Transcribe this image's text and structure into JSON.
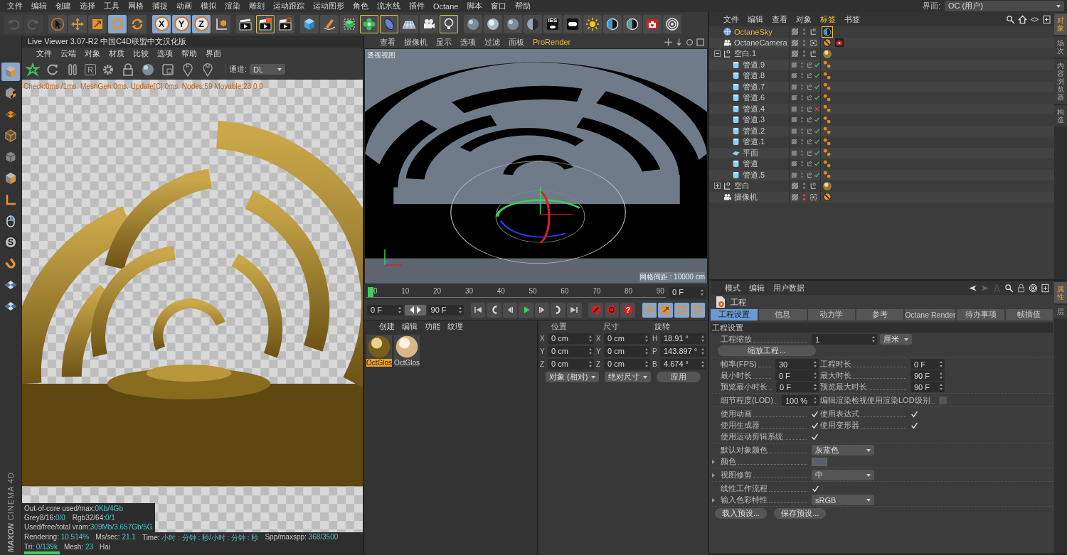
{
  "menu_bar": {
    "items": [
      "文件",
      "编辑",
      "创建",
      "选择",
      "工具",
      "网格",
      "捕捉",
      "动画",
      "模拟",
      "渲染",
      "雕刻",
      "运动跟踪",
      "运动图形",
      "角色",
      "流水线",
      "插件",
      "Octane",
      "脚本",
      "窗口",
      "帮助"
    ],
    "layout_label": "界面:",
    "layout_value": "OC (用户)"
  },
  "toolbar": {
    "groups": [
      [
        {
          "kind": "undo",
          "selected": false,
          "disabled": true
        },
        {
          "kind": "redo",
          "selected": false,
          "disabled": true
        }
      ],
      [
        {
          "kind": "cursor",
          "selected": false,
          "disabled": false
        },
        {
          "kind": "move",
          "selected": false,
          "disabled": false
        },
        {
          "kind": "scale",
          "selected": false,
          "disabled": false
        },
        {
          "kind": "rotate",
          "selected": true,
          "disabled": false
        },
        {
          "kind": "rotate",
          "selected": false,
          "disabled": false
        }
      ],
      [
        {
          "kind": "axis",
          "label": "X",
          "selected": true,
          "disabled": false
        },
        {
          "kind": "axis",
          "label": "Y",
          "selected": true,
          "disabled": false
        },
        {
          "kind": "axis",
          "label": "Z",
          "selected": true,
          "disabled": false
        },
        {
          "kind": "coord",
          "selected": false,
          "disabled": false
        }
      ],
      [
        {
          "kind": "clapper",
          "selected": false,
          "disabled": false
        },
        {
          "kind": "clapper-edit",
          "selected": true,
          "disabled": false
        },
        {
          "kind": "clapper-gear",
          "selected": false,
          "disabled": false
        }
      ],
      [
        {
          "kind": "cube",
          "selected": false,
          "disabled": false
        },
        {
          "kind": "pen",
          "selected": false,
          "disabled": false
        },
        {
          "kind": "green-cube",
          "selected": false,
          "disabled": false
        },
        {
          "kind": "cloner",
          "selected": true,
          "disabled": false
        },
        {
          "kind": "deformer",
          "selected": true,
          "disabled": false
        },
        {
          "kind": "floor",
          "selected": false,
          "disabled": false
        },
        {
          "kind": "camera",
          "selected": false,
          "disabled": false
        },
        {
          "kind": "light",
          "selected": true,
          "disabled": false
        }
      ],
      [
        {
          "kind": "sphere",
          "selected": false,
          "disabled": false
        },
        {
          "kind": "sphere-white",
          "selected": false,
          "disabled": false
        },
        {
          "kind": "sphere",
          "selected": false,
          "disabled": false
        },
        {
          "kind": "sphere-half",
          "selected": false,
          "disabled": false
        },
        {
          "kind": "ies",
          "label": "IES",
          "selected": false,
          "disabled": false
        },
        {
          "kind": "area",
          "selected": false,
          "disabled": false
        },
        {
          "kind": "sun",
          "selected": false,
          "disabled": false
        },
        {
          "kind": "half-blue",
          "selected": false,
          "disabled": false
        },
        {
          "kind": "half-teal",
          "selected": false,
          "disabled": false
        },
        {
          "kind": "camera-red",
          "selected": false,
          "disabled": false
        },
        {
          "kind": "target",
          "selected": false,
          "disabled": false
        }
      ]
    ]
  },
  "left_tools": [
    {
      "kind": "cube-orange",
      "selected": true
    },
    {
      "kind": "checker-cube",
      "selected": false
    },
    {
      "kind": "checker-plane",
      "selected": false
    },
    {
      "kind": "cube-outline",
      "selected": false
    },
    {
      "kind": "cube-grey",
      "selected": false
    },
    {
      "kind": "cube-orange",
      "selected": false
    },
    {
      "kind": "l-axis",
      "selected": false
    },
    {
      "kind": "mouse",
      "selected": false
    },
    {
      "kind": "circle-letter",
      "label": "S",
      "selected": false
    },
    {
      "kind": "magnet",
      "selected": false
    },
    {
      "kind": "checker-grid",
      "selected": false
    },
    {
      "kind": "checker-grid",
      "selected": false
    }
  ],
  "brand": {
    "maker": "MAXON",
    "product": "CINEMA 4D"
  },
  "live_viewer": {
    "title": "Live Viewer 3.07-R2 中国C4D联盟中文汉化版",
    "menu": [
      "文件",
      "云端",
      "对象",
      "材质",
      "比较",
      "选项",
      "帮助",
      "界面"
    ],
    "tools": [
      {
        "kind": "flower"
      },
      {
        "kind": "refresh"
      },
      {
        "kind": "pause"
      },
      {
        "kind": "letter-box",
        "label": "R"
      },
      {
        "kind": "gear"
      },
      {
        "kind": "lock"
      },
      {
        "kind": "sphere"
      },
      {
        "kind": "square"
      },
      {
        "kind": "pin",
        "label": "F"
      },
      {
        "kind": "pin",
        "label": "M"
      }
    ],
    "channel_label": "通道:",
    "channel_value": "DL",
    "status_text": "Check:0ms./1ms. MeshGen:0ms. Update[C]:0ms. Nodes:59 Movable:23  0 0",
    "stats": [
      [
        {
          "label": "Out-of-core used/max:",
          "value": "0Kb/4Gb"
        }
      ],
      [
        {
          "label": "Grey8/16:",
          "value": "0/0"
        },
        {
          "label": "Rgb32/64:",
          "value": "0/1"
        }
      ],
      [
        {
          "label": "Used/free/total vram:",
          "value": "309Mb/3.657Gb/5G"
        }
      ]
    ],
    "status_bar": [
      {
        "label": "Rendering:",
        "value": "10.514%"
      },
      {
        "label": "Ms/sec:",
        "value": "21.1"
      },
      {
        "label": "Time:",
        "value": "小时 : 分钟 : 秒/小时 : 分钟 : 秒"
      },
      {
        "label": "Spp/maxspp:",
        "value": "368/3500"
      },
      {
        "label": "Tri:",
        "value": "0/139k"
      },
      {
        "label": "Mesh:",
        "value": "23"
      },
      {
        "label": "Hai"
      }
    ],
    "progress": {
      "level": 0.105
    }
  },
  "viewport": {
    "menu": [
      {
        "label": "查看",
        "accent": false
      },
      {
        "label": "摄像机",
        "accent": false
      },
      {
        "label": "显示",
        "accent": false
      },
      {
        "label": "选项",
        "accent": false
      },
      {
        "label": "过滤",
        "accent": false
      },
      {
        "label": "面板",
        "accent": false
      },
      {
        "label": "ProRender",
        "accent": true
      }
    ],
    "nav": [
      {
        "kind": "pan"
      },
      {
        "kind": "zoom"
      },
      {
        "kind": "orbit"
      },
      {
        "kind": "maximize"
      }
    ],
    "view_label": "透视视图",
    "grid_label": "网格间距 : 10000 cm"
  },
  "timeline": {
    "ticks": [
      "0",
      "10",
      "20",
      "30",
      "40",
      "50",
      "60",
      "70",
      "80",
      "90"
    ],
    "playhead": {
      "level": 0
    },
    "current_frame": "0 F"
  },
  "transport": {
    "start": "0 F",
    "end": "90 F",
    "buttons": [
      {
        "kind": "go-start",
        "selected": false
      },
      {
        "kind": "prev-key",
        "selected": false
      },
      {
        "kind": "prev-frame",
        "selected": false
      },
      {
        "kind": "play",
        "selected": false
      },
      {
        "kind": "next-frame",
        "selected": false
      },
      {
        "kind": "next-key",
        "selected": false
      },
      {
        "kind": "go-end",
        "selected": false
      },
      {
        "kind": "record",
        "selected": false
      },
      {
        "kind": "autokey",
        "selected": false
      },
      {
        "kind": "help",
        "label": "?",
        "selected": false
      },
      {
        "kind": "move",
        "selected": true
      },
      {
        "kind": "scale",
        "selected": true
      },
      {
        "kind": "rotate",
        "selected": true
      },
      {
        "kind": "param",
        "selected": true
      }
    ]
  },
  "material_manager": {
    "menu": [
      "创建",
      "编辑",
      "功能",
      "纹理"
    ],
    "materials": [
      {
        "name": "OctGlos",
        "kind": "gold",
        "selected": true
      },
      {
        "name": "OctGlos",
        "kind": "cream",
        "selected": false
      }
    ]
  },
  "coordinates": {
    "headers": [
      "位置",
      "尺寸",
      "旋转"
    ],
    "rows": [
      {
        "position_axis": "X",
        "position": "0 cm",
        "size_axis": "X",
        "size": "0 cm",
        "rotation_axis": "H",
        "rotation": "18.91 °"
      },
      {
        "position_axis": "Y",
        "position": "0 cm",
        "size_axis": "Y",
        "size": "0 cm",
        "rotation_axis": "P",
        "rotation": "143.897 °"
      },
      {
        "position_axis": "Z",
        "position": "0 cm",
        "size_axis": "Z",
        "size": "0 cm",
        "rotation_axis": "B",
        "rotation": "4.674 °"
      }
    ],
    "mode": "对象 (相对)",
    "size_mode": "绝对尺寸",
    "apply": "应用"
  },
  "object_manager": {
    "menu": [
      {
        "label": "文件",
        "selected": false
      },
      {
        "label": "编辑",
        "selected": false
      },
      {
        "label": "查看",
        "selected": false
      },
      {
        "label": "对象",
        "selected": false
      },
      {
        "label": "标签",
        "selected": true
      },
      {
        "label": "书签",
        "selected": false
      }
    ],
    "header_icons": [
      {
        "kind": "search"
      },
      {
        "kind": "home"
      },
      {
        "kind": "diamond"
      },
      {
        "kind": "new-window"
      }
    ],
    "objects": [
      {
        "name": "OctaneSky",
        "kind": "sky",
        "selected": true,
        "hidden": false,
        "protected": false,
        "tags": [
          {
            "kind": "sky-tag",
            "selected": true
          }
        ]
      },
      {
        "name": "OctaneCamera",
        "kind": "camera",
        "selected": false,
        "hidden": false,
        "protected": true,
        "tags": [
          {
            "kind": "target-tag",
            "selected": false
          },
          {
            "kind": "camera-tag",
            "selected": false
          }
        ]
      },
      {
        "name": "空白.1",
        "kind": "null",
        "selected": false,
        "expanded": true,
        "hidden": false,
        "protected": false,
        "tags": [
          {
            "kind": "material",
            "selected": false
          }
        ],
        "children": [
          {
            "name": "管道.9",
            "kind": "tube",
            "selected": false,
            "hidden": false,
            "protected": false,
            "enabled": true,
            "tags": [
              {
                "kind": "octane-tag",
                "selected": false
              }
            ]
          },
          {
            "name": "管道.8",
            "kind": "tube",
            "selected": false,
            "hidden": false,
            "protected": false,
            "enabled": true,
            "tags": [
              {
                "kind": "octane-tag",
                "selected": false
              }
            ]
          },
          {
            "name": "管道.7",
            "kind": "tube",
            "selected": false,
            "hidden": false,
            "protected": false,
            "enabled": true,
            "tags": [
              {
                "kind": "octane-tag",
                "selected": false
              }
            ]
          },
          {
            "name": "管道.6",
            "kind": "tube",
            "selected": false,
            "hidden": false,
            "protected": false,
            "enabled": true,
            "tags": [
              {
                "kind": "octane-tag",
                "selected": false
              }
            ]
          },
          {
            "name": "管道.4",
            "kind": "tube",
            "selected": false,
            "hidden": false,
            "protected": false,
            "enabled": false,
            "tags": [
              {
                "kind": "octane-tag",
                "selected": false
              }
            ]
          },
          {
            "name": "管道.3",
            "kind": "tube",
            "selected": false,
            "hidden": false,
            "protected": false,
            "enabled": true,
            "tags": [
              {
                "kind": "octane-tag",
                "selected": false
              }
            ]
          },
          {
            "name": "管道.2",
            "kind": "tube",
            "selected": false,
            "hidden": false,
            "protected": false,
            "enabled": true,
            "tags": [
              {
                "kind": "octane-tag",
                "selected": false
              }
            ]
          },
          {
            "name": "管道.1",
            "kind": "tube",
            "selected": false,
            "hidden": false,
            "protected": false,
            "enabled": true,
            "tags": [
              {
                "kind": "octane-tag",
                "selected": false
              }
            ]
          },
          {
            "name": "平面",
            "kind": "plane",
            "selected": false,
            "hidden": false,
            "protected": false,
            "enabled": true,
            "tags": [
              {
                "kind": "octane-tag",
                "selected": false
              }
            ]
          },
          {
            "name": "管道",
            "kind": "tube",
            "selected": false,
            "hidden": false,
            "protected": false,
            "enabled": true,
            "tags": [
              {
                "kind": "octane-tag",
                "selected": false
              }
            ]
          },
          {
            "name": "管道.5",
            "kind": "tube",
            "selected": false,
            "hidden": false,
            "protected": false,
            "enabled": true,
            "tags": [
              {
                "kind": "octane-tag",
                "selected": false
              }
            ]
          }
        ]
      },
      {
        "name": "空白",
        "kind": "null",
        "selected": false,
        "expanded": false,
        "hidden": false,
        "protected": false,
        "tags": [
          {
            "kind": "material",
            "selected": false
          }
        ]
      },
      {
        "name": "摄像机",
        "kind": "camera",
        "selected": false,
        "hidden": true,
        "protected": true,
        "tags": [
          {
            "kind": "target-tag",
            "selected": false
          }
        ]
      }
    ],
    "side_tabs": [
      {
        "label": "对象",
        "selected": true
      },
      {
        "label": "场次",
        "selected": false
      },
      {
        "label": "内容浏览器",
        "selected": false
      },
      {
        "label": "构造",
        "selected": false
      }
    ]
  },
  "attribute_manager": {
    "menu": [
      "模式",
      "编辑",
      "用户数据"
    ],
    "header_icons": [
      {
        "kind": "back"
      },
      {
        "kind": "forward"
      },
      {
        "kind": "up"
      },
      {
        "kind": "search"
      },
      {
        "kind": "lock"
      },
      {
        "kind": "target"
      },
      {
        "kind": "new-window"
      }
    ],
    "title": "工程",
    "tabs": [
      {
        "label": "工程设置",
        "selected": true
      },
      {
        "label": "信息",
        "selected": false
      },
      {
        "label": "动力学",
        "selected": false
      },
      {
        "label": "参考",
        "selected": false
      },
      {
        "label": "Octane Render",
        "selected": false
      },
      {
        "label": "待办事项",
        "selected": false
      },
      {
        "label": "帧插值",
        "selected": false
      }
    ],
    "section": "工程设置",
    "groups": [
      {
        "kind": "single",
        "fields": [
          {
            "kind": "number_unit",
            "label": "工程缩放",
            "value": "1",
            "unit": "厘米",
            "expander": false
          },
          {
            "kind": "button",
            "label": "缩放工程...",
            "expander": false
          }
        ]
      },
      {
        "kind": "pairs",
        "fields": [
          {
            "kind": "number",
            "label": "帧率(FPS)",
            "value": "30",
            "expander": false
          },
          {
            "kind": "number",
            "label": "工程时长",
            "value": "0 F",
            "expander": false
          },
          {
            "kind": "number",
            "label": "最小时长",
            "value": "0 F",
            "expander": false
          },
          {
            "kind": "number",
            "label": "最大时长",
            "value": "90 F",
            "expander": false
          },
          {
            "kind": "number",
            "label": "预览最小时长",
            "value": "0 F",
            "expander": false
          },
          {
            "kind": "number",
            "label": "预览最大时长",
            "value": "90 F",
            "expander": false
          }
        ]
      },
      {
        "kind": "pairs",
        "fields": [
          {
            "kind": "number",
            "label": "细节程度(LOD)",
            "value": "100 %",
            "expander": false
          },
          {
            "kind": "checkbox",
            "label": "编辑渲染检视使用渲染LOD级别",
            "checked": false,
            "expander": false
          }
        ]
      },
      {
        "kind": "pairs",
        "fields": [
          {
            "kind": "checkbox",
            "label": "使用动画",
            "checked": true,
            "expander": false
          },
          {
            "kind": "checkbox",
            "label": "使用表达式",
            "checked": true,
            "expander": false
          },
          {
            "kind": "checkbox",
            "label": "使用生成器",
            "checked": true,
            "expander": false
          },
          {
            "kind": "checkbox",
            "label": "使用变形器",
            "checked": true,
            "expander": false
          },
          {
            "kind": "checkbox",
            "label": "使用运动剪辑系统",
            "checked": true,
            "expander": false
          }
        ]
      },
      {
        "kind": "single",
        "fields": [
          {
            "kind": "dropdown",
            "label": "默认对象颜色",
            "value": "灰蓝色",
            "expander": false
          },
          {
            "kind": "color",
            "label": "颜色",
            "color": "#56616c",
            "expander": true
          }
        ]
      },
      {
        "kind": "single",
        "fields": [
          {
            "kind": "dropdown",
            "label": "视图修剪",
            "value": "中",
            "expander": true
          }
        ]
      },
      {
        "kind": "single",
        "fields": [
          {
            "kind": "checkbox",
            "label": "线性工作流程",
            "checked": true,
            "expander": false
          },
          {
            "kind": "dropdown",
            "label": "输入色彩特性",
            "value": "sRGB",
            "expander": true
          }
        ]
      }
    ],
    "footer_buttons": [
      "载入预设...",
      "保存预设..."
    ],
    "side_tabs": [
      {
        "label": "属性",
        "selected": true
      },
      {
        "label": "层",
        "selected": false
      }
    ]
  }
}
